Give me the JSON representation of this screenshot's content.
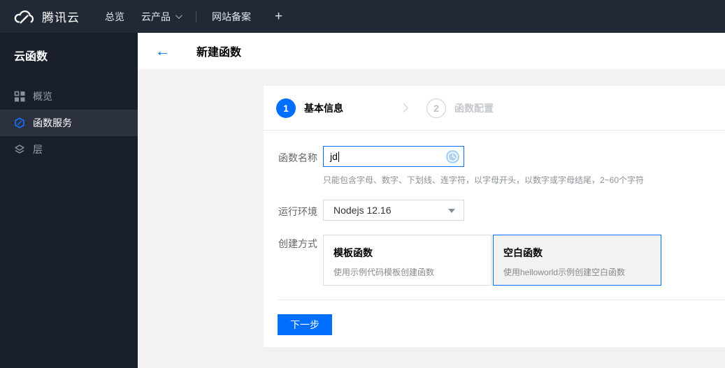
{
  "colors": {
    "accent": "#006eff",
    "topbar_bg": "#222936",
    "sidebar_bg": "#1a202b",
    "sidebar_active_bg": "#2b313e",
    "content_bg": "#f2f2f2",
    "selected_card_bg": "#f2f2f2",
    "pending_step": "#c5c9ce",
    "loading_icon_blue": "#a9d2f5"
  },
  "topbar": {
    "brand": "腾讯云",
    "logo_icon": "tencent-cloud-logo",
    "items": [
      {
        "label": "总览"
      },
      {
        "label": "云产品",
        "caret": "chevron-down-icon"
      },
      {
        "label": "网站备案"
      },
      {
        "label": "+"
      }
    ]
  },
  "sidebar": {
    "title": "云函数",
    "items": [
      {
        "label": "概览",
        "icon": "grid-icon",
        "active": false
      },
      {
        "label": "函数服务",
        "icon": "hexagon-slash-icon",
        "active": true
      },
      {
        "label": "层",
        "icon": "layers-icon",
        "active": false
      }
    ]
  },
  "header": {
    "back_icon": "←",
    "title": "新建函数"
  },
  "wizard": {
    "steps": [
      {
        "num": "1",
        "label": "基本信息",
        "state": "active"
      },
      {
        "num": "2",
        "label": "函数配置",
        "state": "pending"
      }
    ]
  },
  "form": {
    "name": {
      "label": "函数名称",
      "value": "jd",
      "status_icon": "clock-loading-icon",
      "help": "只能包含字母、数字、下划线、连字符，以字母开头，以数字或字母结尾，2~60个字符"
    },
    "runtime": {
      "label": "运行环境",
      "value": "Nodejs 12.16"
    },
    "method": {
      "label": "创建方式",
      "options": [
        {
          "title": "模板函数",
          "desc": "使用示例代码模板创建函数",
          "selected": false
        },
        {
          "title": "空白函数",
          "desc": "使用helloworld示例创建空白函数",
          "selected": true
        }
      ]
    }
  },
  "footer": {
    "next_label": "下一步"
  }
}
